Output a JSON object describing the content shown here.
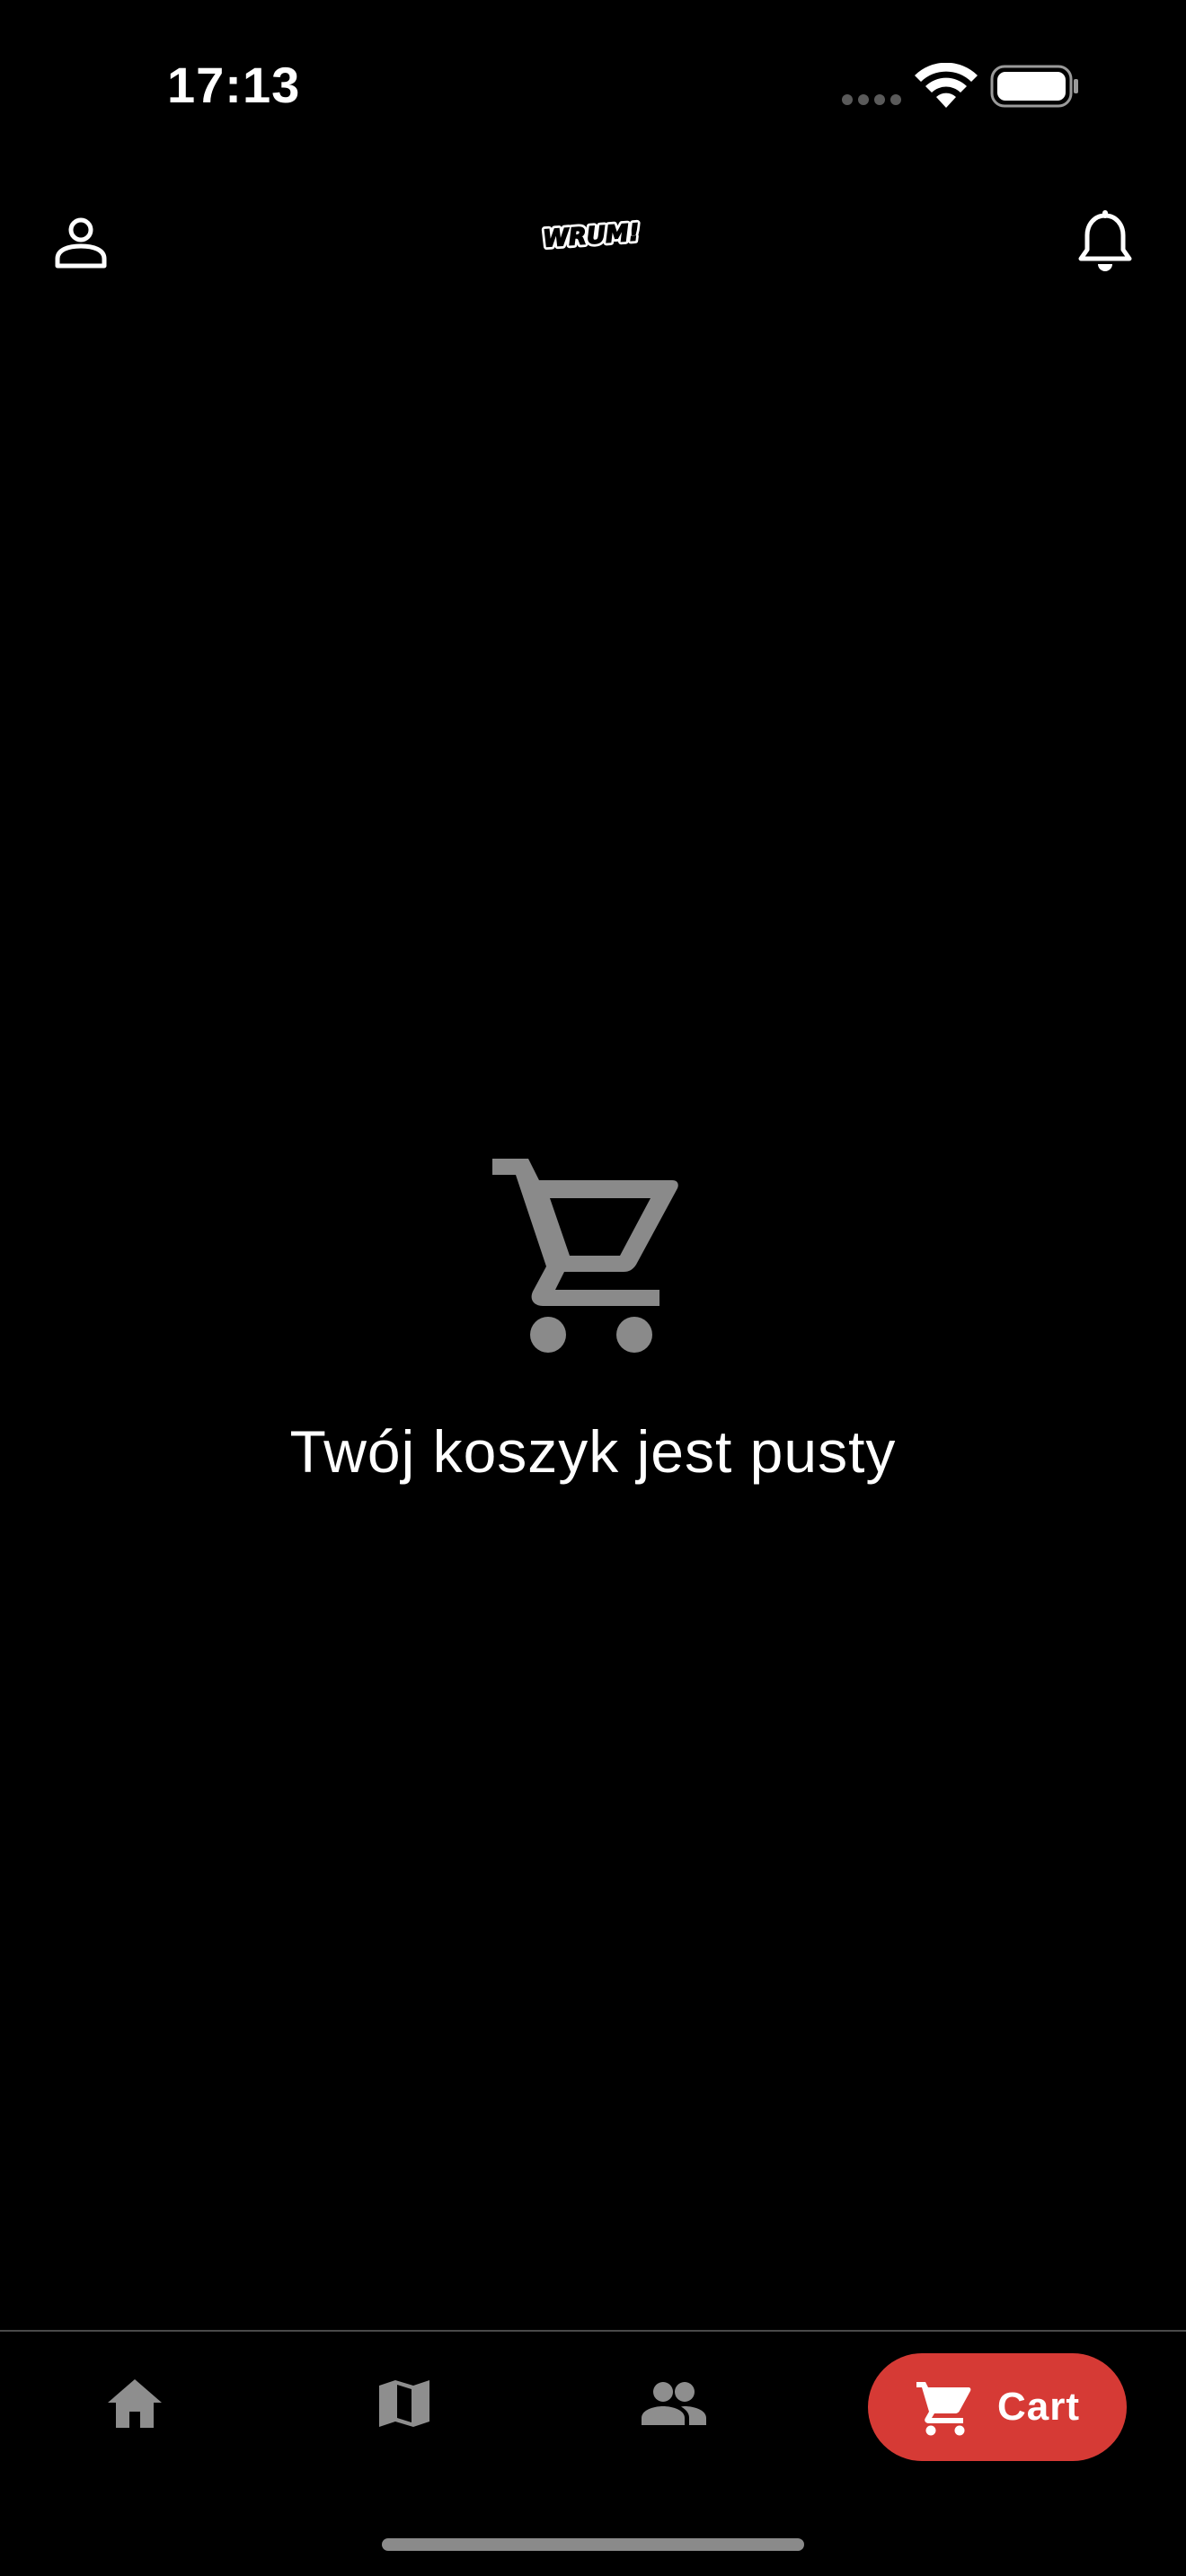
{
  "status_bar": {
    "time": "17:13"
  },
  "top_bar": {
    "logo_text": "WRUM!"
  },
  "empty_state": {
    "message": "Twój koszyk jest pusty"
  },
  "bottom_nav": {
    "items": [
      {
        "icon": "home-icon",
        "label": ""
      },
      {
        "icon": "map-icon",
        "label": ""
      },
      {
        "icon": "people-icon",
        "label": ""
      },
      {
        "icon": "cart-icon",
        "label": "Cart",
        "active": true
      }
    ]
  },
  "colors": {
    "background": "#000000",
    "accent": "#d63a35",
    "icon_inactive": "#8e8e8e",
    "empty_icon": "#8a8a8a",
    "text": "#ffffff"
  }
}
